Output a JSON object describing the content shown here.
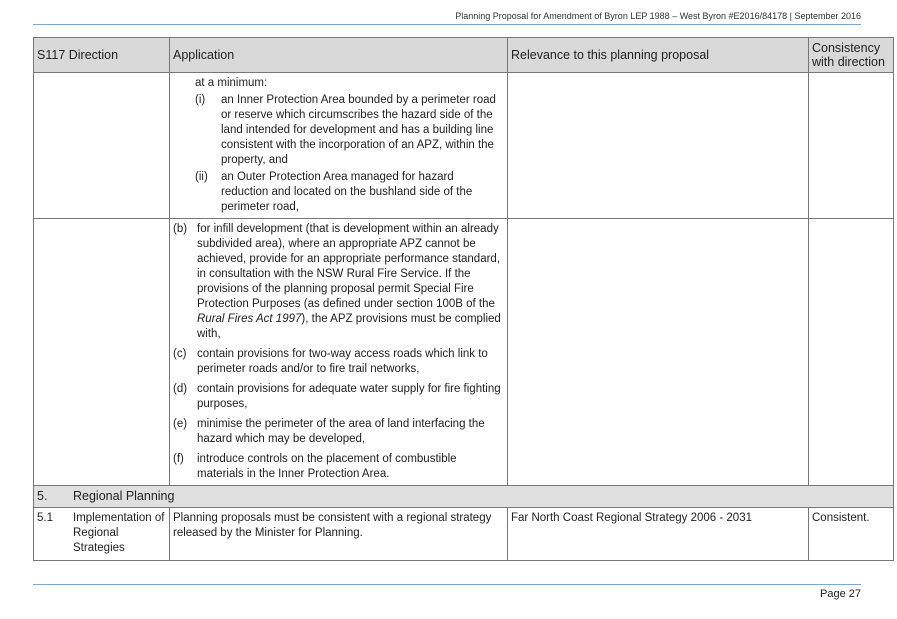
{
  "header": {
    "text": "Planning Proposal for Amendment of Byron LEP 1988 – West Byron #E2016/84178 | September 2016"
  },
  "table": {
    "columns": [
      "S117 Direction",
      "Application",
      "Relevance to this planning proposal",
      "Consistency with direction"
    ],
    "row1": {
      "lead": "at a minimum:",
      "items": [
        {
          "label": "(i)",
          "text": "an Inner Protection Area bounded by a perimeter road or reserve which circumscribes the hazard side of the land intended for development and has a building line consistent with the incorporation of an APZ, within the property, and"
        },
        {
          "label": "(ii)",
          "text": "an Outer Protection Area managed for hazard reduction and located on the bushland side of the perimeter road,"
        }
      ]
    },
    "row2": {
      "b_label": "(b)",
      "b_text_1": "for infill development (that is development within an already subdivided area), where an appropriate APZ cannot be achieved, provide for an appropriate performance standard, in consultation with the NSW Rural Fire Service.  If the provisions of the planning proposal permit Special Fire Protection Purposes (as defined under section 100B of the ",
      "b_text_italic": "Rural Fires Act 1997",
      "b_text_2": "), the APZ provisions must be complied with,",
      "items": [
        {
          "label": "(c)",
          "text": "contain provisions for two-way access roads which link to perimeter roads and/or to fire trail networks,"
        },
        {
          "label": "(d)",
          "text": "contain provisions for adequate water supply for fire fighting purposes,"
        },
        {
          "label": "(e)",
          "text": "minimise the perimeter of the area of land interfacing the hazard which may be developed,"
        },
        {
          "label": "(f)",
          "text": "introduce controls on the placement of combustible materials in the Inner Protection Area."
        }
      ]
    },
    "section": {
      "number": "5.",
      "title": "Regional Planning"
    },
    "row51": {
      "number": "5.1",
      "direction": "Implementation of Regional Strategies",
      "application": "Planning proposals must be consistent with a regional strategy released by the Minister for Planning.",
      "relevance": "Far North Coast Regional Strategy 2006 - 2031",
      "consistency": "Consistent."
    }
  },
  "footer": {
    "page": "Page 27"
  }
}
